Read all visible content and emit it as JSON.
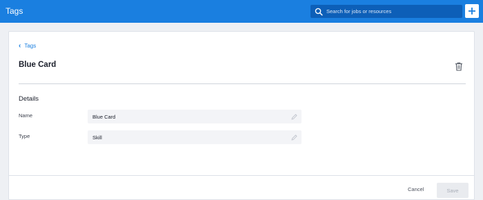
{
  "header": {
    "title": "Tags",
    "search": {
      "placeholder": "Search for jobs or resources",
      "value": ""
    },
    "add_icon": "plus-icon",
    "brand_color": "#1a7fe0"
  },
  "breadcrumb": {
    "label": "Tags",
    "icon": "chevron-left-icon"
  },
  "page": {
    "title": "Blue Card",
    "delete_icon": "trash-icon"
  },
  "details": {
    "section_title": "Details",
    "fields": [
      {
        "label": "Name",
        "value": "Blue Card",
        "icon": "pencil-icon"
      },
      {
        "label": "Type",
        "value": "Skill",
        "icon": "pencil-icon"
      }
    ]
  },
  "footer": {
    "cancel_label": "Cancel",
    "save_label": "Save"
  }
}
